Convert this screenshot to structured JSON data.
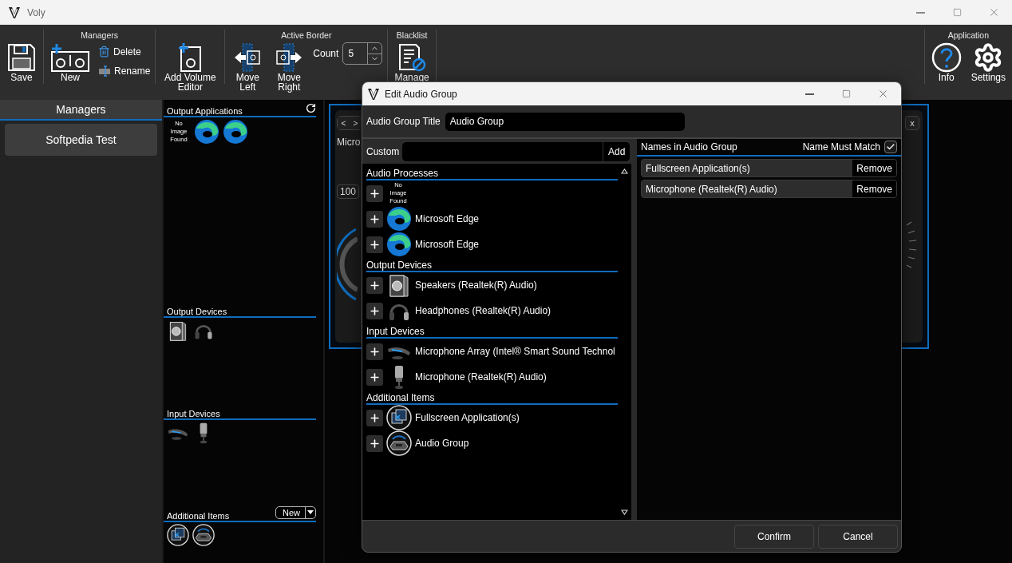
{
  "window": {
    "title": "Voly"
  },
  "toolbar": {
    "save": "Save",
    "managers": {
      "label": "Managers",
      "new": "New",
      "delete": "Delete",
      "rename": "Rename"
    },
    "add_volume_editor": "Add Volume Editor",
    "active_border": {
      "label": "Active Border",
      "move_left": "Move Left",
      "move_right": "Move Right",
      "count_label": "Count",
      "count_value": "5"
    },
    "blacklist": {
      "label": "Blacklist",
      "manage": "Manage"
    },
    "application": {
      "label": "Application",
      "info": "Info",
      "settings": "Settings"
    }
  },
  "sidebar": {
    "title": "Managers",
    "items": [
      {
        "label": "Softpedia Test",
        "selected": true
      }
    ]
  },
  "device_panel": {
    "sections": [
      {
        "title": "Output Applications",
        "action": {
          "kind": "refresh"
        },
        "items": [
          {
            "kind": "missing",
            "label": "No Image Found"
          },
          {
            "kind": "edge"
          },
          {
            "kind": "edge"
          }
        ]
      },
      {
        "title": "Output Devices",
        "items": [
          {
            "kind": "speaker"
          },
          {
            "kind": "headphones"
          }
        ]
      },
      {
        "title": "Input Devices",
        "items": [
          {
            "kind": "mic_array"
          },
          {
            "kind": "microphone"
          }
        ]
      },
      {
        "title": "Additional Items",
        "action": {
          "kind": "new",
          "label": "New"
        },
        "items": [
          {
            "kind": "fullscreen"
          },
          {
            "kind": "group"
          }
        ]
      }
    ]
  },
  "volume_editor": {
    "prev": "<",
    "next": ">",
    "name": "Micro",
    "volume": "100",
    "close": "x"
  },
  "dialog": {
    "title": "Edit Audio Group",
    "title_label": "Audio Group Title",
    "title_value": "Audio Group",
    "custom_label": "Custom",
    "custom_button": "Add",
    "sections": [
      {
        "title": "Audio Processes",
        "items": [
          {
            "kind": "missing",
            "label": "No Image Found"
          },
          {
            "kind": "edge",
            "label": "Microsoft Edge"
          },
          {
            "kind": "edge",
            "label": "Microsoft Edge"
          }
        ]
      },
      {
        "title": "Output Devices",
        "items": [
          {
            "kind": "speaker",
            "label": "Speakers (Realtek(R) Audio)"
          },
          {
            "kind": "headphones",
            "label": "Headphones (Realtek(R) Audio)"
          }
        ]
      },
      {
        "title": "Input Devices",
        "items": [
          {
            "kind": "mic_array",
            "label": "Microphone Array (Intel® Smart Sound Technol"
          },
          {
            "kind": "microphone",
            "label": "Microphone (Realtek(R) Audio)"
          }
        ]
      },
      {
        "title": "Additional Items",
        "items": [
          {
            "kind": "fullscreen",
            "label": "Fullscreen Application(s)"
          },
          {
            "kind": "group",
            "label": "Audio Group"
          }
        ]
      }
    ],
    "names_header": "Names in Audio Group",
    "name_must_match": {
      "label": "Name Must Match",
      "checked": true
    },
    "names": [
      {
        "label": "Fullscreen Application(s)",
        "button": "Remove"
      },
      {
        "label": "Microphone (Realtek(R) Audio)",
        "button": "Remove"
      }
    ],
    "buttons": [
      "Confirm",
      "Cancel"
    ]
  }
}
